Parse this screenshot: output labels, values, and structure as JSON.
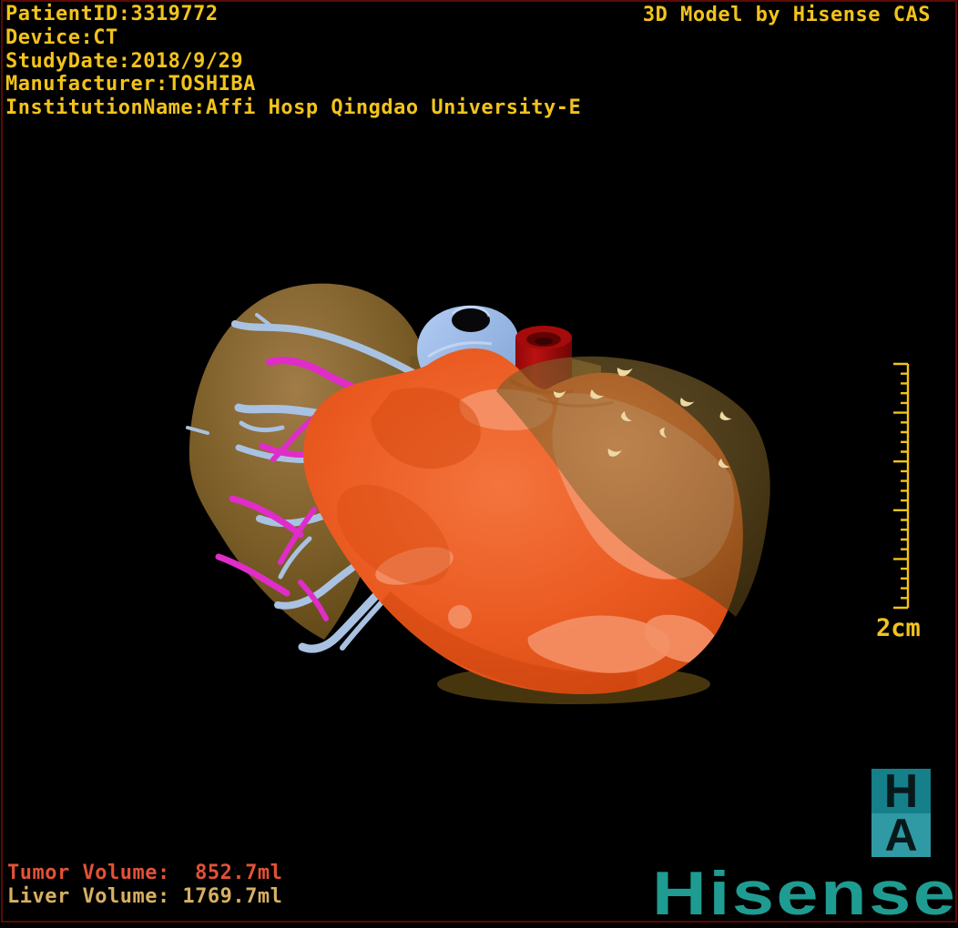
{
  "header": {
    "patient_id_line": "PatientID:3319772",
    "device_line": "Device:CT",
    "study_date_line": "StudyDate:2018/9/29",
    "manufacturer_line": "Manufacturer:TOSHIBA",
    "institution_line": "InstitutionName:Affi Hosp Qingdao University-E",
    "title": "3D Model by Hisense CAS"
  },
  "footer": {
    "tumor_volume_line": "Tumor Volume:  852.7ml",
    "liver_volume_line": "Liver Volume: 1769.7ml"
  },
  "scale_bar": {
    "label": "2cm"
  },
  "branding": {
    "wordmark": "Hisense",
    "badge_top_letter": "H",
    "badge_bottom_letter": "A"
  },
  "colors": {
    "background": "#000000",
    "frame_border": "#5a0a06",
    "annotation_yellow": "#f2c31b",
    "tumor_text": "#e25237",
    "liver_text": "#d8b061",
    "hisense_teal": "#1f9c92",
    "badge_top_teal": "#157f8a",
    "badge_bottom_teal": "#2f9aa3",
    "badge_letter": "#07181b",
    "liver_surface": "#8a6b30",
    "tumor_orange": "#ec5a20",
    "tumor_patch_light": "#f49066",
    "portal_vein_blue": "#a9c2e2",
    "artery_magenta": "#e02cc8",
    "vena_cava_red": "#a50b0b",
    "surface_marks": "#ecd9a4"
  }
}
